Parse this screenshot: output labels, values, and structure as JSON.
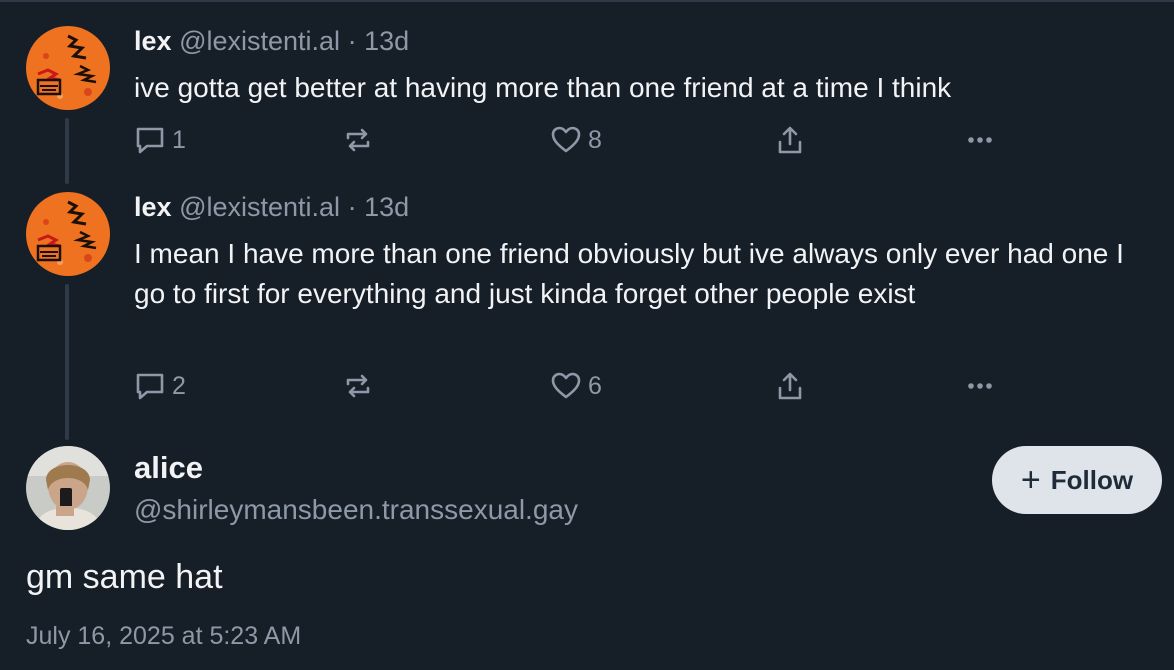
{
  "posts": [
    {
      "name": "lex",
      "handle": "@lexistenti.al",
      "separator": "·",
      "age": "13d",
      "text": "ive gotta get better at having more than one friend at a time I think",
      "reply_count": "1",
      "like_count": "8"
    },
    {
      "name": "lex",
      "handle": "@lexistenti.al",
      "separator": "·",
      "age": "13d",
      "text": "I mean I have more than one friend obviously but ive always only ever had one I go to first for everything and just kinda forget other people exist",
      "reply_count": "2",
      "like_count": "6"
    }
  ],
  "focus_post": {
    "name": "alice",
    "handle": "@shirleymansbeen.transsexual.gay",
    "follow_label": "Follow",
    "text": "gm same hat",
    "timestamp": "July 16, 2025 at 5:23 AM"
  },
  "icons": {
    "reply": "reply-icon",
    "repost": "repost-icon",
    "like": "heart-icon",
    "share": "share-icon",
    "more": "more-icon",
    "follow": "plus-icon"
  },
  "colors": {
    "background": "#161e27",
    "text": "#f1f3f5",
    "muted": "#8d99a7",
    "follow_button": "#dfe4ea",
    "avatar_lex": "#ef7220"
  }
}
